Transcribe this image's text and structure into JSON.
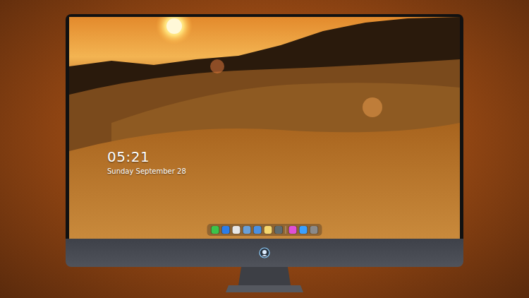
{
  "desktop": {
    "clock": "05:21",
    "date": "Sunday September 28"
  },
  "dock": {
    "items": [
      {
        "color": "#3bc44b"
      },
      {
        "color": "#2b7de9"
      },
      {
        "color": "#e6e6e6"
      },
      {
        "color": "#6aa0d8"
      },
      {
        "color": "#4a90e2"
      },
      {
        "color": "#f5d76e"
      },
      {
        "color": "#5f6b6e"
      },
      {
        "color": "#e04fd6"
      },
      {
        "color": "#3aa0ff"
      },
      {
        "color": "#8a8a8a"
      }
    ]
  }
}
